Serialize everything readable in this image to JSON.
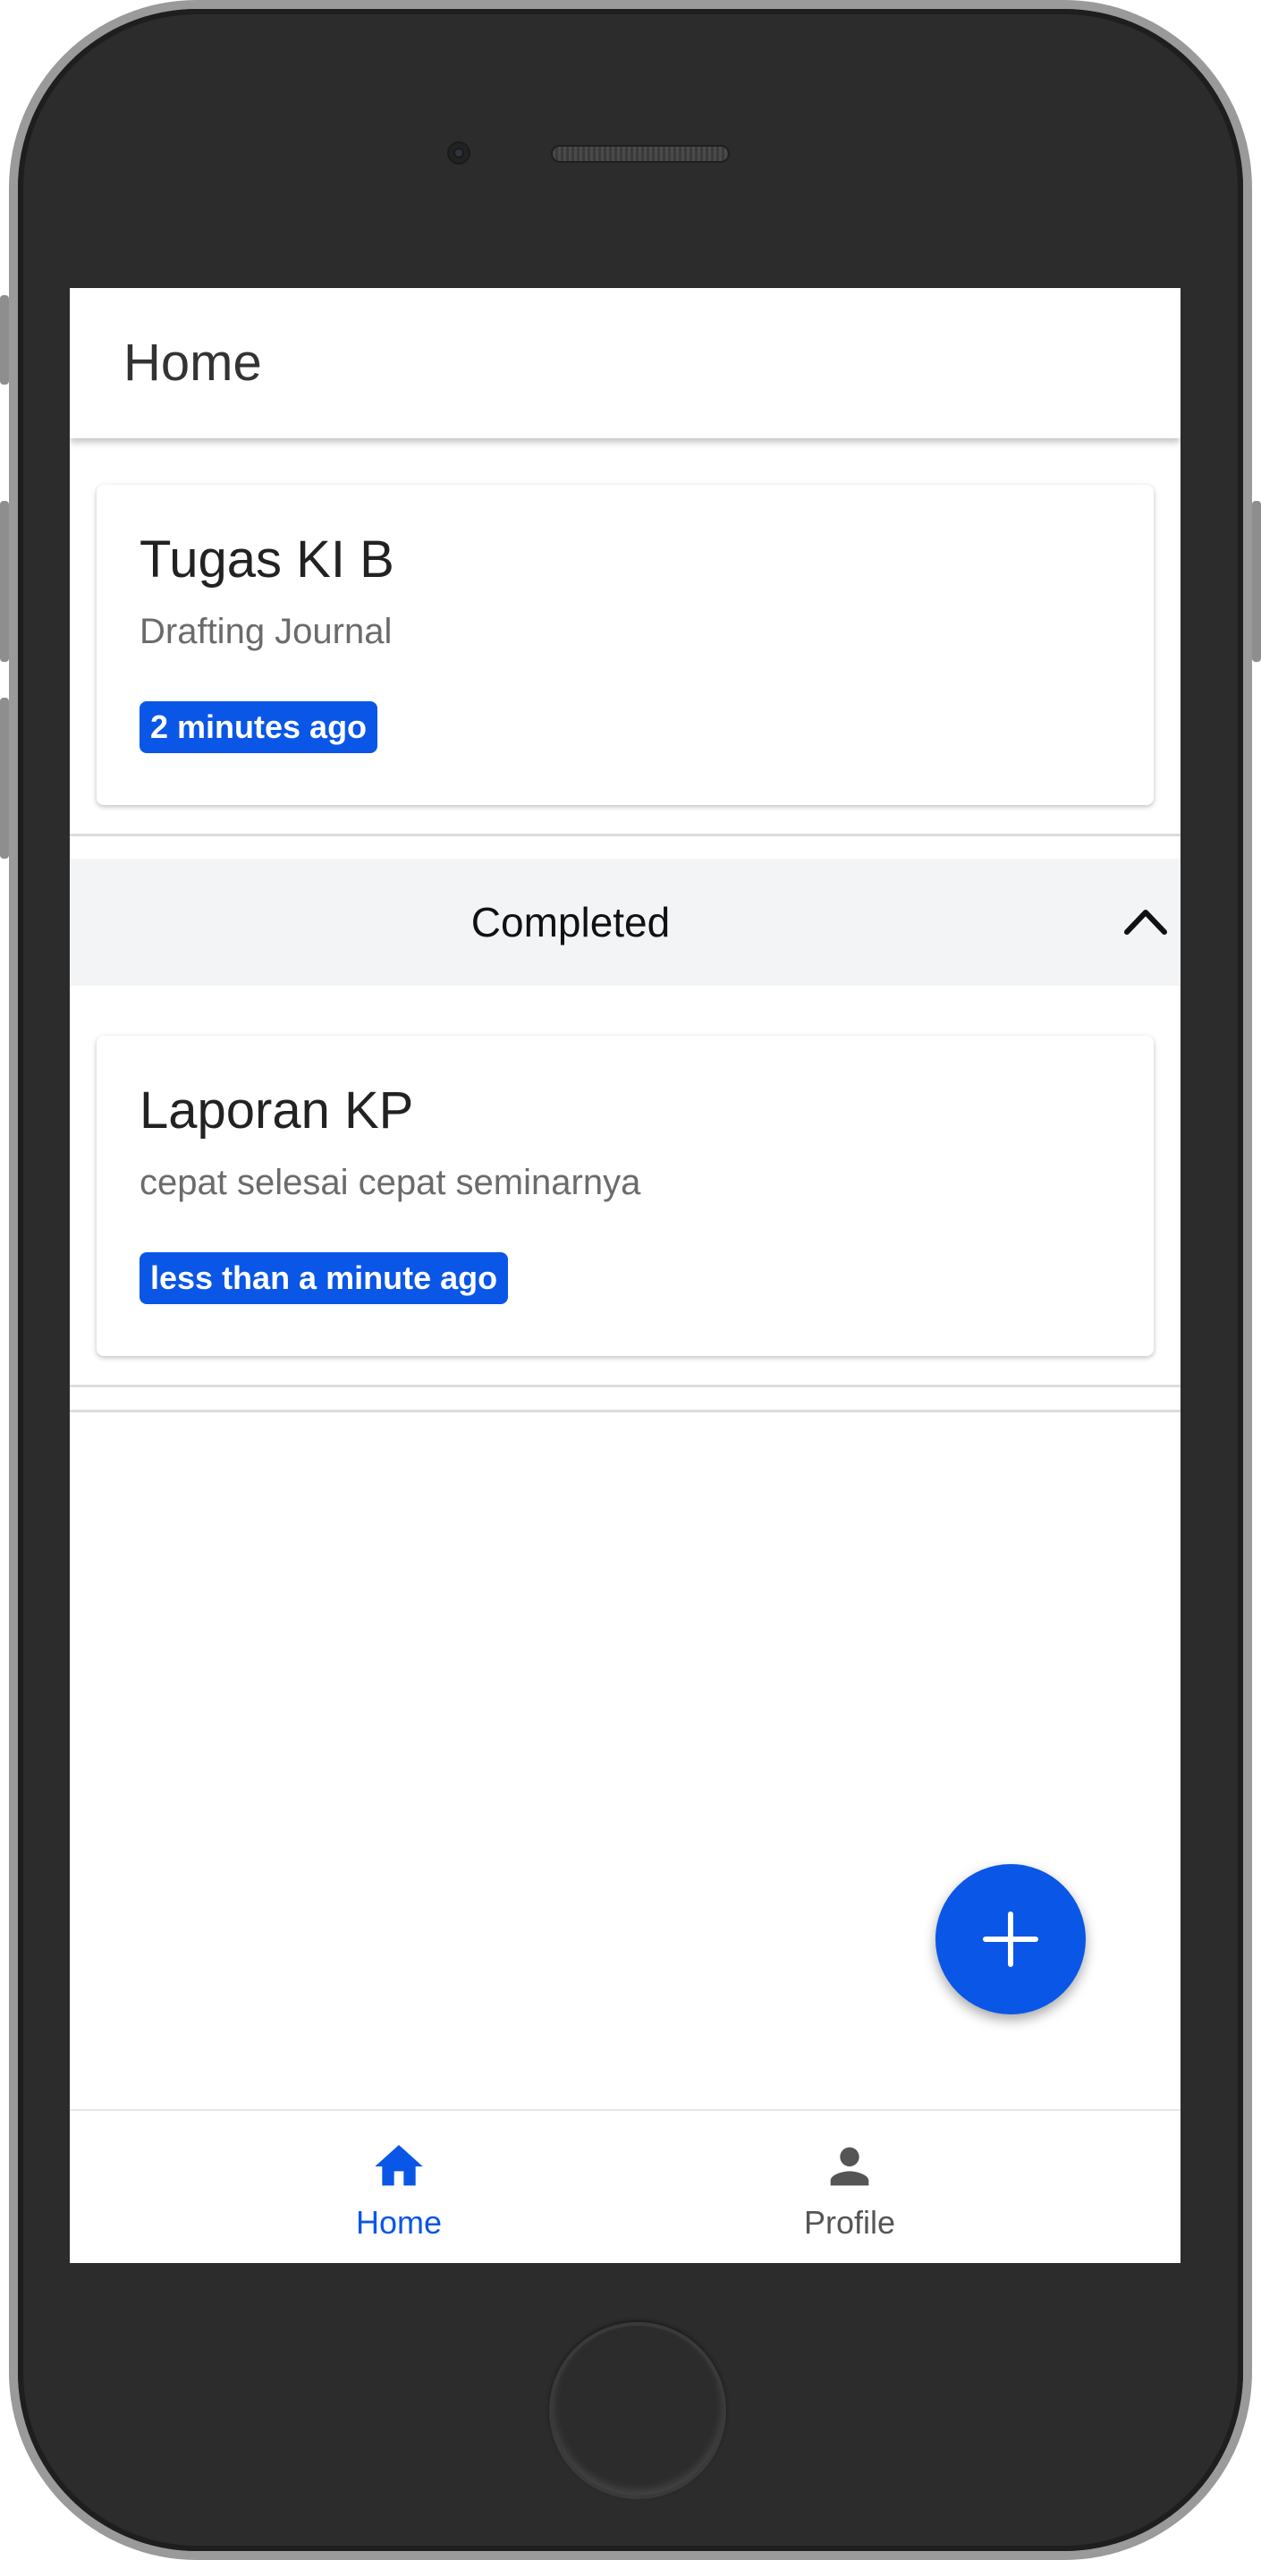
{
  "app_bar": {
    "title": "Home"
  },
  "tasks": [
    {
      "title": "Tugas KI B",
      "description": "Drafting Journal",
      "time": "2 minutes ago"
    }
  ],
  "completed_section": {
    "label": "Completed",
    "expanded": true,
    "icon": "chevron-up-icon"
  },
  "completed_tasks": [
    {
      "title": "Laporan KP",
      "description": "cepat selesai cepat seminarnya",
      "time": "less than a minute ago"
    }
  ],
  "fab": {
    "icon": "plus-icon"
  },
  "bottom_nav": {
    "items": [
      {
        "label": "Home",
        "icon": "home-icon",
        "active": true
      },
      {
        "label": "Profile",
        "icon": "person-icon",
        "active": false
      }
    ]
  },
  "colors": {
    "accent": "#0a56e6",
    "inactive": "#555555",
    "section_bg": "#f3f4f6"
  }
}
